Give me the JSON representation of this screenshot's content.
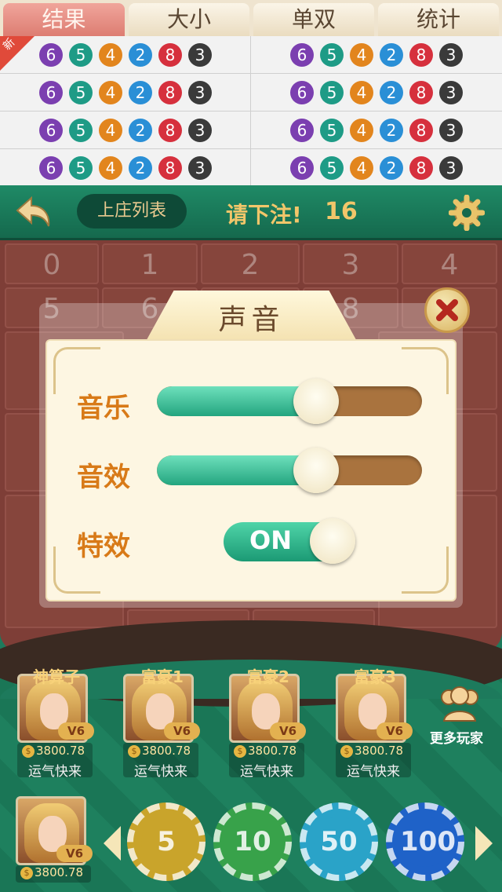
{
  "tabs": [
    {
      "label": "结果",
      "active": true
    },
    {
      "label": "大小",
      "active": false
    },
    {
      "label": "单双",
      "active": false
    },
    {
      "label": "统计",
      "active": false
    }
  ],
  "new_badge": "新",
  "results": {
    "rows": [
      {
        "left": [
          "6",
          "5",
          "4",
          "2",
          "8",
          "3"
        ],
        "right": [
          "6",
          "5",
          "4",
          "2",
          "8",
          "3"
        ]
      },
      {
        "left": [
          "6",
          "5",
          "4",
          "2",
          "8",
          "3"
        ],
        "right": [
          "6",
          "5",
          "4",
          "2",
          "8",
          "3"
        ]
      },
      {
        "left": [
          "6",
          "5",
          "4",
          "2",
          "8",
          "3"
        ],
        "right": [
          "6",
          "5",
          "4",
          "2",
          "8",
          "3"
        ]
      },
      {
        "left": [
          "6",
          "5",
          "4",
          "2",
          "8",
          "3"
        ],
        "right": [
          "6",
          "5",
          "4",
          "2",
          "8",
          "3"
        ]
      }
    ],
    "ball_colors": {
      "6": "#7b3fb0",
      "5": "#1e9b86",
      "4": "#e2851d",
      "2": "#2a8fd6",
      "8": "#d6303d",
      "3": "#3a3a3a"
    }
  },
  "header": {
    "back_icon": "back-arrow-icon",
    "dealer_label": "上庄列表",
    "bet_prompt": "请下注!",
    "bet_countdown": "16",
    "settings_icon": "gear-icon"
  },
  "table_numbers": [
    "0",
    "1",
    "2",
    "3",
    "4",
    "5",
    "6",
    "8"
  ],
  "dialog": {
    "title": "声音",
    "close_icon": "close-icon",
    "music_label": "音乐",
    "music_level": 0.6,
    "sfx_label": "音效",
    "sfx_level": 0.6,
    "effects_label": "特效",
    "effects_toggle": "ON"
  },
  "players": [
    {
      "name": "神算子",
      "vip": "V6",
      "gold": "3800.78",
      "motto": "运气快来"
    },
    {
      "name": "富豪1",
      "vip": "V6",
      "gold": "3800.78",
      "motto": "运气快来"
    },
    {
      "name": "富豪2",
      "vip": "V6",
      "gold": "3800.78",
      "motto": "运气快来"
    },
    {
      "name": "富豪3",
      "vip": "V6",
      "gold": "3800.78",
      "motto": "运气快来"
    }
  ],
  "more_players_label": "更多玩家",
  "self_player": {
    "vip": "V6",
    "gold": "3800.78"
  },
  "chips": [
    {
      "value": "5",
      "color": "#c9a42b"
    },
    {
      "value": "10",
      "color": "#38a24a"
    },
    {
      "value": "50",
      "color": "#2aa3c8"
    },
    {
      "value": "100",
      "color": "#1f62c8"
    }
  ],
  "colors": {
    "title_gold": "#f2c66a",
    "label_orange": "#d87a18",
    "felt_green": "#1d7a5c"
  }
}
